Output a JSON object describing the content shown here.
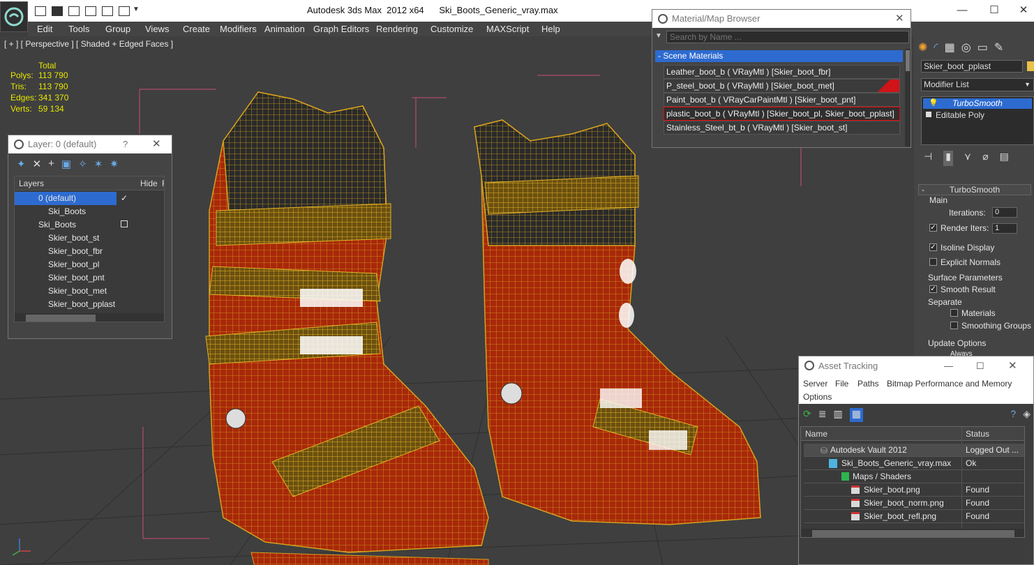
{
  "titlebar": {
    "title": "Autodesk 3ds Max  2012 x64      Ski_Boots_Generic_vray.max"
  },
  "menu": [
    "Edit",
    "Tools",
    "Group",
    "Views",
    "Create",
    "Modifiers",
    "Animation",
    "Graph Editors",
    "Rendering",
    "Customize",
    "MAXScript",
    "Help"
  ],
  "viewport": {
    "label": "[ + ] [ Perspective ] [ Shaded + Edged Faces ]",
    "stats": {
      "header": "Total",
      "rows": [
        {
          "label": "Polys:",
          "value": "113 790"
        },
        {
          "label": "Tris:",
          "value": "113 790"
        },
        {
          "label": "Edges:",
          "value": "341 370"
        },
        {
          "label": "Verts:",
          "value": "59 134"
        }
      ]
    }
  },
  "layer_dialog": {
    "title": "Layer: 0 (default)",
    "help": "?",
    "col_layers": "Layers",
    "col_hide": "Hide",
    "col_f": "F",
    "rows": [
      {
        "name": "0 (default)"
      },
      {
        "name": "Ski_Boots"
      },
      {
        "name": "Ski_Boots"
      },
      {
        "name": "Skier_boot_st"
      },
      {
        "name": "Skier_boot_fbr"
      },
      {
        "name": "Skier_boot_pl"
      },
      {
        "name": "Skier_boot_pnt"
      },
      {
        "name": "Skier_boot_met"
      },
      {
        "name": "Skier_boot_pplast"
      }
    ]
  },
  "material_browser": {
    "title": "Material/Map Browser",
    "search_placeholder": "Search by Name ...",
    "section": "- Scene Materials",
    "materials": [
      "Leather_boot_b  ( VRayMtl ) [Skier_boot_fbr]",
      "P_steel_boot_b  ( VRayMtl ) [Skier_boot_met]",
      "Paint_boot_b  ( VRayCarPaintMtl ) [Skier_boot_pnt]",
      "plastic_boot_b ( VRayMtl ) [Skier_boot_pl, Skier_boot_pplast]",
      "Stainless_Steel_bt_b  ( VRayMtl ) [Skier_boot_st]"
    ]
  },
  "command_panel": {
    "object_name": "Skier_boot_pplast",
    "modifier_list": "Modifier List",
    "stack": [
      "TurboSmooth",
      "Editable Poly"
    ],
    "rollout_title": "TurboSmooth",
    "main_label": "Main",
    "iterations_label": "Iterations:",
    "iterations_value": "0",
    "render_iters_label": "Render Iters:",
    "render_iters_value": "1",
    "isoline": "Isoline Display",
    "explicit_normals": "Explicit Normals",
    "surface_params": "Surface Parameters",
    "smooth_result": "Smooth Result",
    "separate": "Separate",
    "materials": "Materials",
    "smoothing_groups": "Smoothing Groups",
    "update_options": "Update Options",
    "always": "Always"
  },
  "asset_tracking": {
    "title": "Asset Tracking",
    "menu": [
      "Server",
      "File",
      "Paths",
      "Bitmap Performance and Memory",
      "Options"
    ],
    "col_name": "Name",
    "col_status": "Status",
    "rows": [
      {
        "name": "Autodesk Vault 2012",
        "status": "Logged Out ..."
      },
      {
        "name": "Ski_Boots_Generic_vray.max",
        "status": "Ok"
      },
      {
        "name": "Maps / Shaders",
        "status": ""
      },
      {
        "name": "Skier_boot.png",
        "status": "Found"
      },
      {
        "name": "Skier_boot_norm.png",
        "status": "Found"
      },
      {
        "name": "Skier_boot_refl.png",
        "status": "Found"
      }
    ]
  },
  "colors": {
    "wire": "#d6a21e",
    "boot_red": "#a8280a",
    "accent_blue": "#2d6bd0",
    "stat_yellow": "#e6e600"
  }
}
